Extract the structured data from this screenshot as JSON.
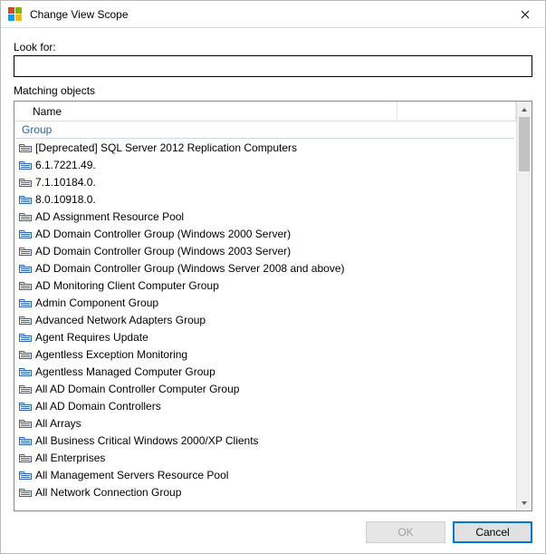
{
  "window": {
    "title": "Change View Scope"
  },
  "lookfor": {
    "label": "Look for:",
    "value": ""
  },
  "matching": {
    "label": "Matching objects",
    "column_name": "Name",
    "group_label": "Group"
  },
  "items": [
    {
      "name": "[Deprecated] SQL Server 2012 Replication Computers"
    },
    {
      "name": "6.1.7221.49."
    },
    {
      "name": "7.1.10184.0."
    },
    {
      "name": "8.0.10918.0."
    },
    {
      "name": "AD Assignment Resource Pool"
    },
    {
      "name": "AD Domain Controller Group (Windows 2000 Server)"
    },
    {
      "name": "AD Domain Controller Group (Windows 2003 Server)"
    },
    {
      "name": "AD Domain Controller Group (Windows Server 2008 and above)"
    },
    {
      "name": "AD Monitoring Client Computer Group"
    },
    {
      "name": "Admin Component Group"
    },
    {
      "name": "Advanced Network Adapters Group"
    },
    {
      "name": "Agent Requires Update"
    },
    {
      "name": "Agentless Exception Monitoring"
    },
    {
      "name": "Agentless Managed Computer Group"
    },
    {
      "name": "All AD Domain Controller Computer Group"
    },
    {
      "name": "All AD Domain Controllers"
    },
    {
      "name": "All Arrays"
    },
    {
      "name": "All Business Critical Windows 2000/XP Clients"
    },
    {
      "name": "All Enterprises"
    },
    {
      "name": "All Management Servers Resource Pool"
    },
    {
      "name": "All Network Connection Group"
    }
  ],
  "buttons": {
    "ok": "OK",
    "cancel": "Cancel"
  },
  "icons": {
    "app_colors": [
      "#d24726",
      "#7fba00",
      "#00a4ef",
      "#ffb900"
    ]
  }
}
